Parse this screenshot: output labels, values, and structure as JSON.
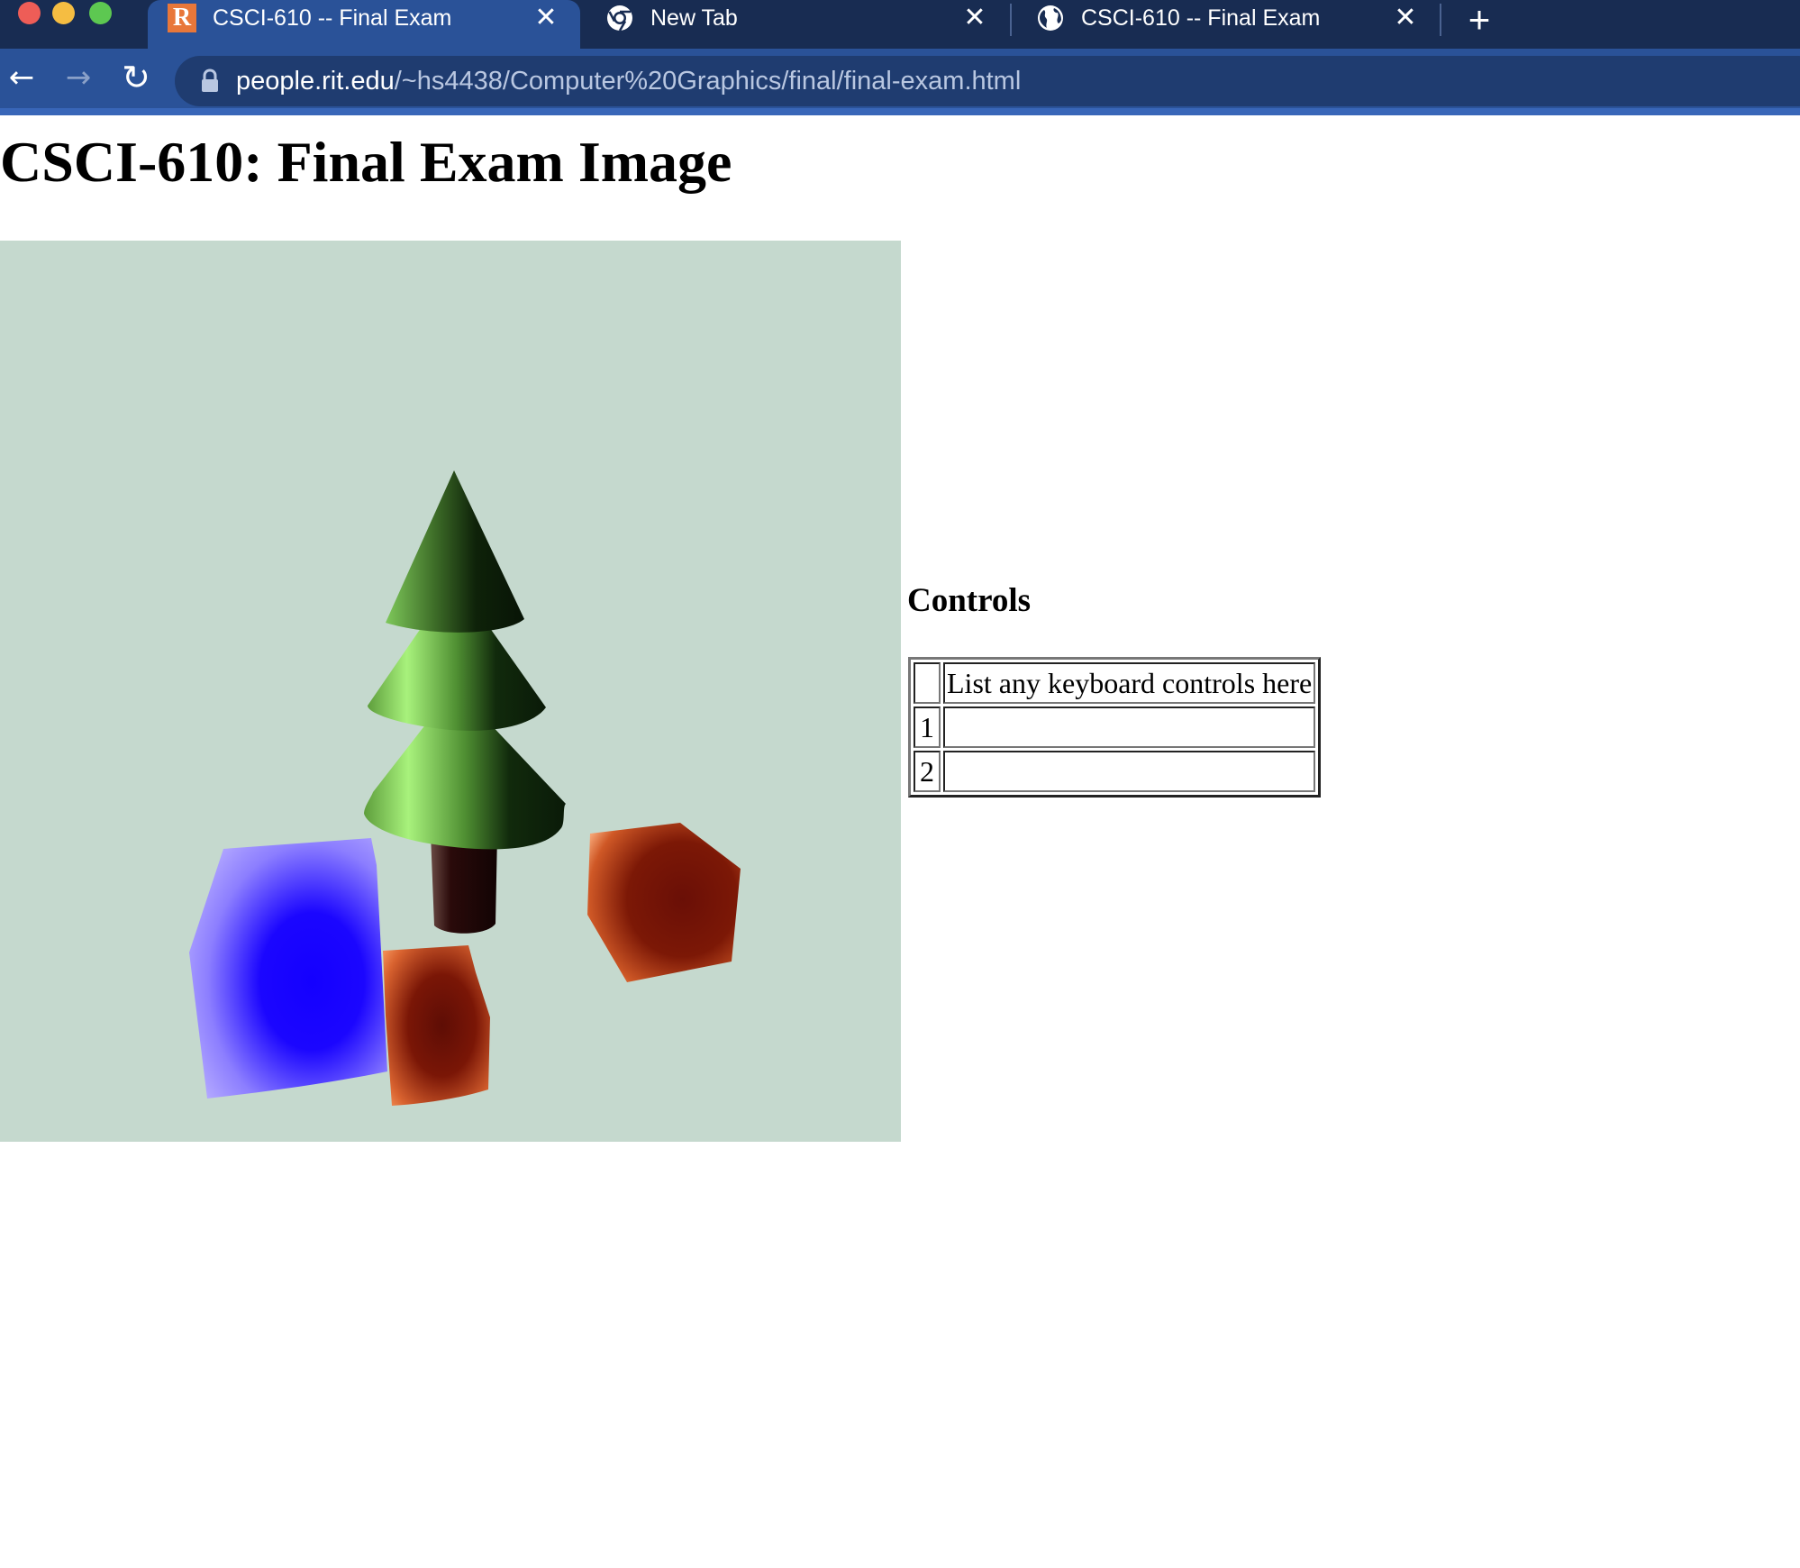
{
  "browser": {
    "tabs": [
      {
        "title": "CSCI-610 -- Final Exam",
        "active": true,
        "icon": "rit-r-icon",
        "icon_letter": "R"
      },
      {
        "title": "New Tab",
        "active": false,
        "icon": "chrome-icon"
      },
      {
        "title": "CSCI-610 -- Final Exam",
        "active": false,
        "icon": "globe-icon"
      }
    ],
    "url_host": "people.rit.edu",
    "url_path": "/~hs4438/Computer%20Graphics/final/final-exam.html",
    "colors": {
      "tabstrip": "#182c52",
      "toolbar": "#2a5298",
      "omnibox": "#1f3c70"
    }
  },
  "page": {
    "title": "CSCI-610: Final Exam Image",
    "canvas": {
      "background": "#c5d9ce",
      "objects": [
        "tree-cones",
        "tree-trunk",
        "blue-cube",
        "orange-cube-front",
        "orange-cube-right"
      ]
    },
    "controls": {
      "heading": "Controls",
      "header_num": "",
      "header_desc": "List any keyboard controls here",
      "rows": [
        {
          "num": "1",
          "desc": ""
        },
        {
          "num": "2",
          "desc": ""
        }
      ]
    }
  }
}
